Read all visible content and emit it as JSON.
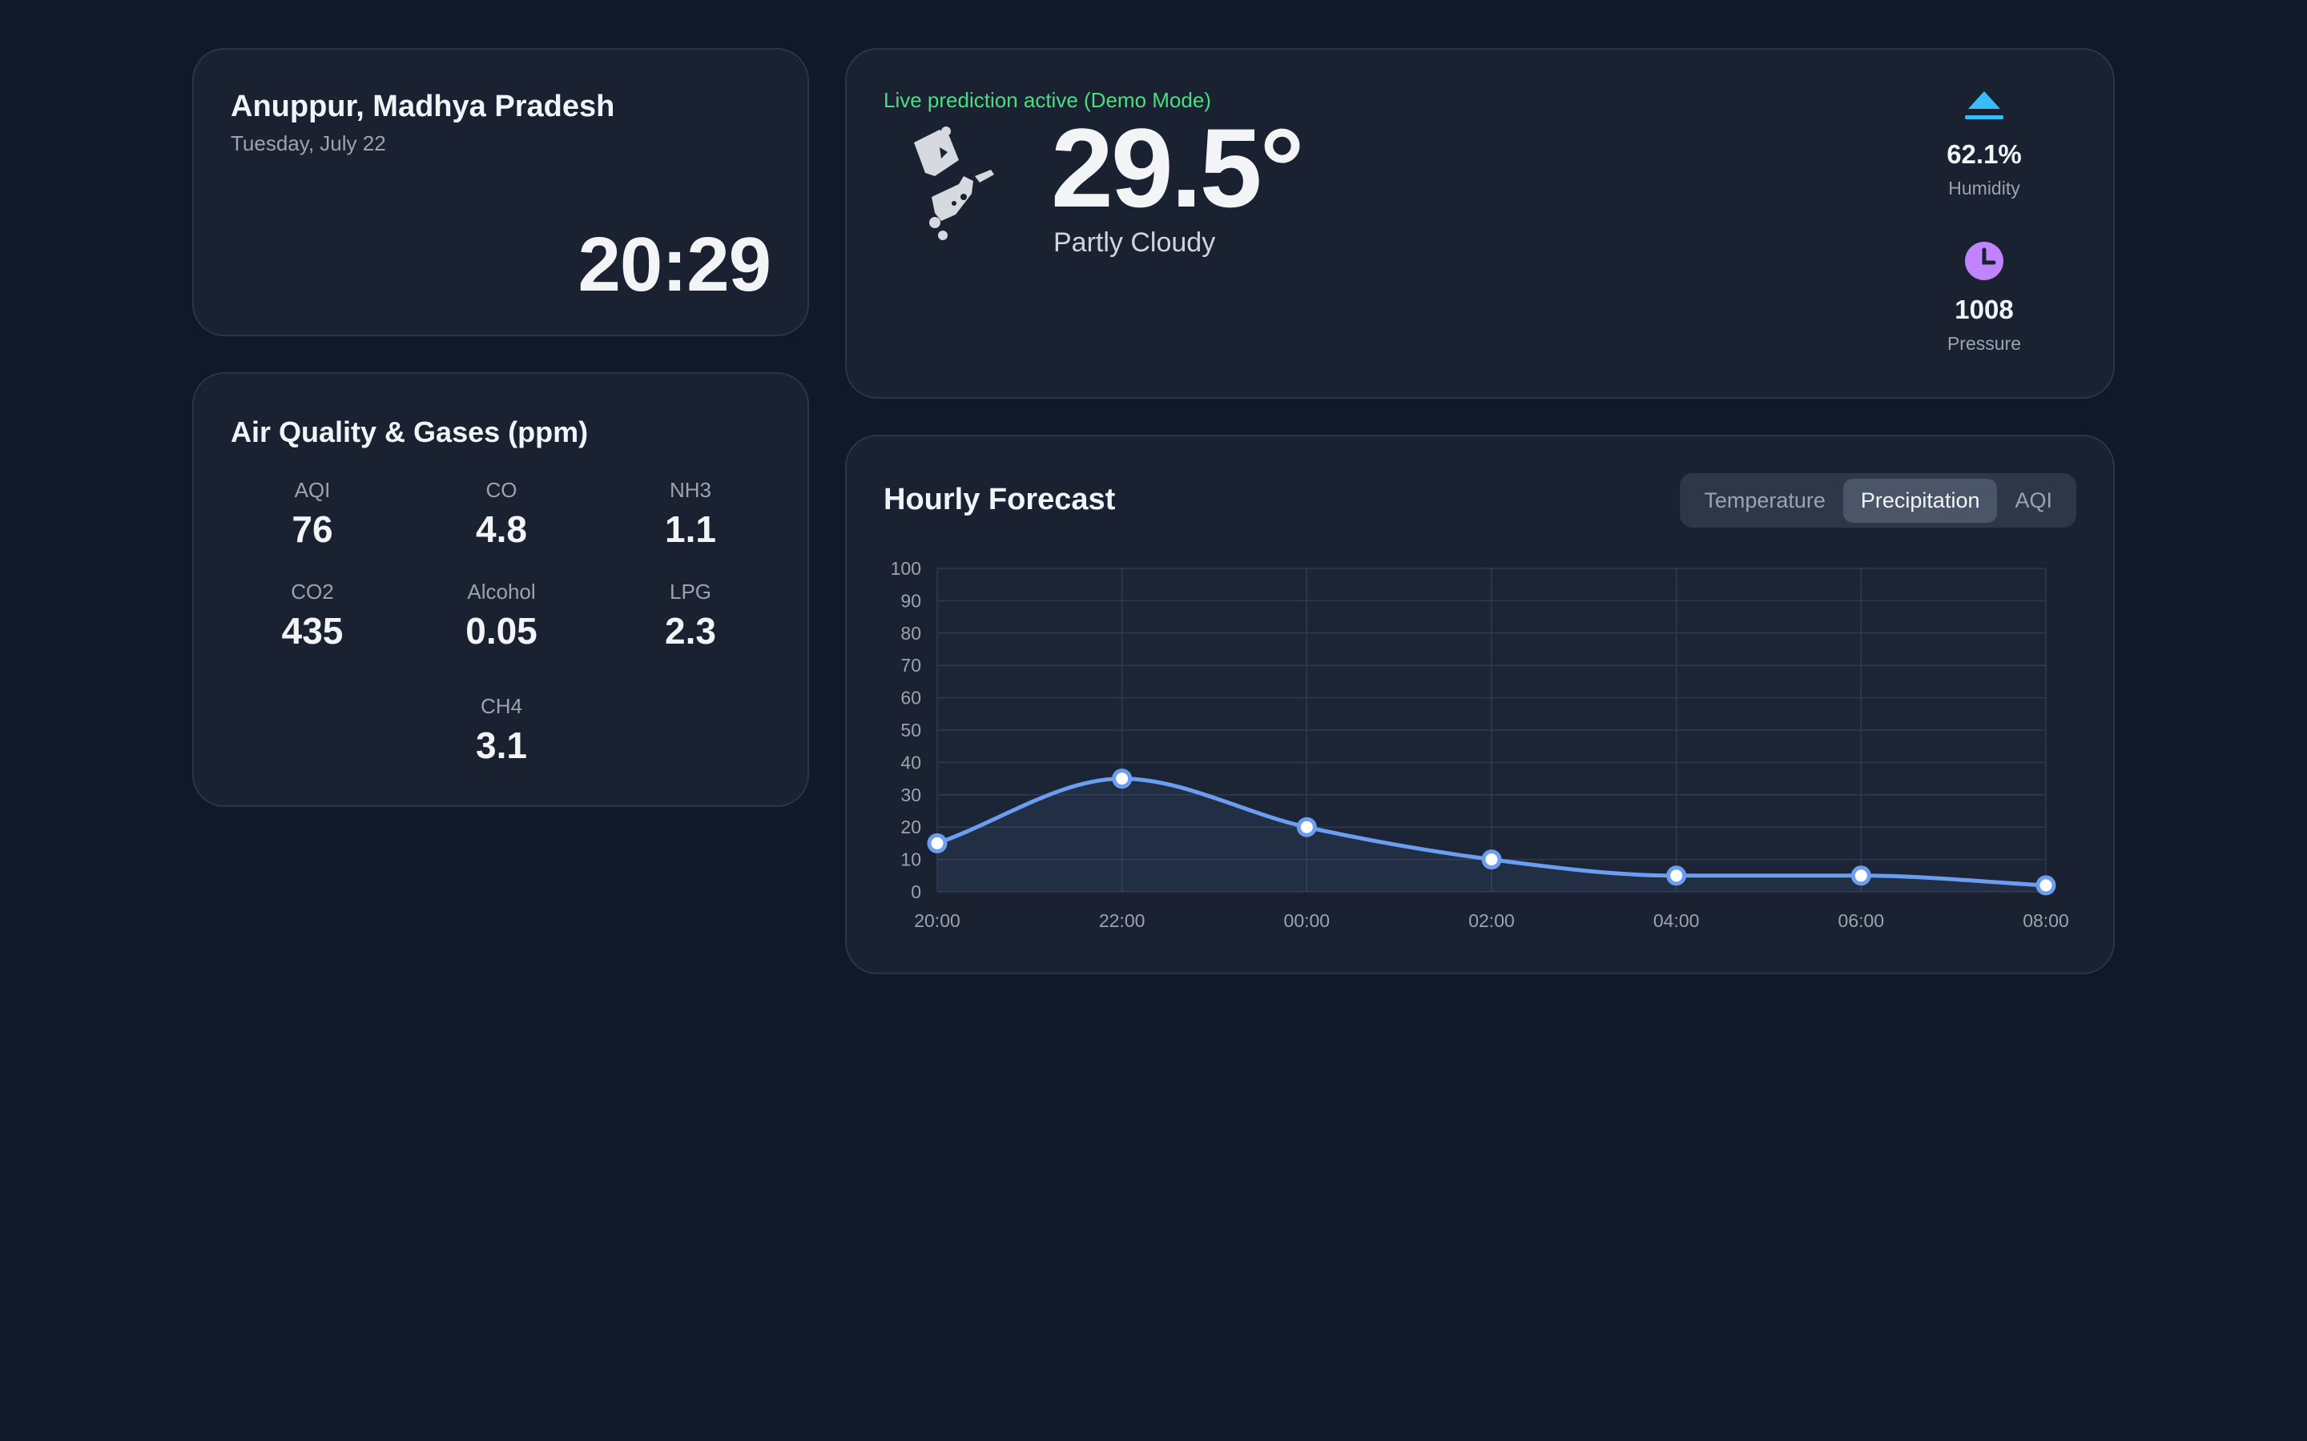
{
  "location": {
    "name": "Anuppur, Madhya Pradesh",
    "date": "Tuesday, July 22",
    "time": "20:29"
  },
  "air_quality": {
    "title": "Air Quality & Gases (ppm)",
    "items": [
      {
        "label": "AQI",
        "value": "76"
      },
      {
        "label": "CO",
        "value": "4.8"
      },
      {
        "label": "NH3",
        "value": "1.1"
      },
      {
        "label": "CO2",
        "value": "435"
      },
      {
        "label": "Alcohol",
        "value": "0.05"
      },
      {
        "label": "LPG",
        "value": "2.3"
      },
      {
        "label": "CH4",
        "value": "3.1"
      }
    ]
  },
  "current": {
    "status": "Live prediction active (Demo Mode)",
    "temperature": "29.5°",
    "condition": "Partly Cloudy",
    "humidity": {
      "value": "62.1%",
      "label": "Humidity",
      "icon": "eject-icon",
      "color": "#38bdf8"
    },
    "pressure": {
      "value": "1008",
      "label": "Pressure",
      "icon": "clock-icon",
      "color": "#c084fc"
    }
  },
  "forecast": {
    "title": "Hourly Forecast",
    "tabs": [
      "Temperature",
      "Precipitation",
      "AQI"
    ],
    "active_tab": "Precipitation"
  },
  "chart_data": {
    "type": "line",
    "x": [
      "20:00",
      "22:00",
      "00:00",
      "02:00",
      "04:00",
      "06:00",
      "08:00"
    ],
    "series": [
      {
        "values": [
          15,
          35,
          20,
          10,
          5,
          5,
          2
        ]
      }
    ],
    "ylim": [
      0,
      100
    ],
    "yticks": [
      0,
      10,
      20,
      30,
      40,
      50,
      60,
      70,
      80,
      90,
      100
    ],
    "grid": true,
    "color": "#6b9ef0"
  }
}
